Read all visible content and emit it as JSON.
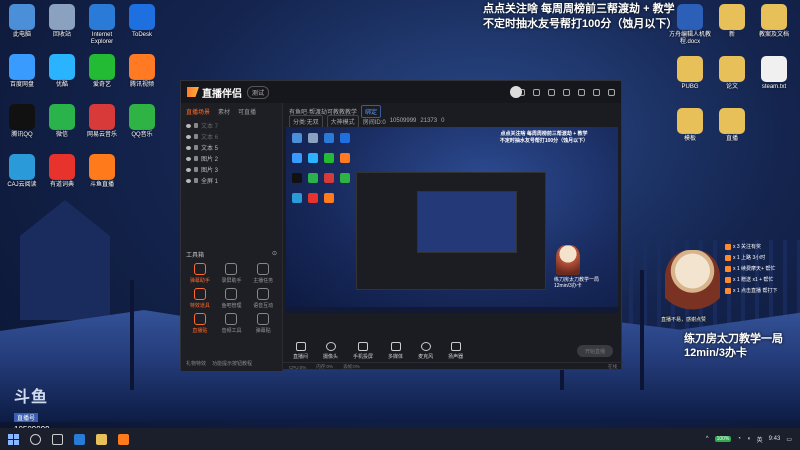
{
  "desktop": {
    "icons_left": [
      {
        "label": "此电脑",
        "icon": "computer-icon",
        "color": "#4a8fd8"
      },
      {
        "label": "回收站",
        "icon": "recycle-bin-icon",
        "color": "#8aa2c0"
      },
      {
        "label": "Internet Explorer",
        "icon": "ie-icon",
        "color": "#2a7ad8"
      },
      {
        "label": "ToDesk",
        "icon": "todesk-icon",
        "color": "#1e6fe0"
      },
      {
        "label": "百度网盘",
        "icon": "baidu-netdisk-icon",
        "color": "#3a9bff"
      },
      {
        "label": "优酷",
        "icon": "youku-icon",
        "color": "#2ab3ff"
      },
      {
        "label": "爱奇艺",
        "icon": "iqiyi-icon",
        "color": "#22bb33"
      },
      {
        "label": "腾讯视频",
        "icon": "tencent-video-icon",
        "color": "#ff7a22"
      },
      {
        "label": "腾讯QQ",
        "icon": "qq-icon",
        "color": "#111111"
      },
      {
        "label": "微信",
        "icon": "wechat-icon",
        "color": "#29b34a"
      },
      {
        "label": "网易云音乐",
        "icon": "netease-music-icon",
        "color": "#d83a3a"
      },
      {
        "label": "QQ音乐",
        "icon": "qq-music-icon",
        "color": "#2fb344"
      },
      {
        "label": "CAJ云阅读",
        "icon": "caj-icon",
        "color": "#2a9ad8"
      },
      {
        "label": "有道词典",
        "icon": "youdao-icon",
        "color": "#e8322c"
      },
      {
        "label": "斗鱼直播",
        "icon": "douyu-icon",
        "color": "#ff7a1a"
      }
    ],
    "icons_right": [
      {
        "label": "方舟编辑人机教程.docx",
        "icon": "word-doc-icon",
        "color": "#2b5fb8"
      },
      {
        "label": "新",
        "icon": "folder-icon",
        "color": "#e8c05a"
      },
      {
        "label": "教案及文档",
        "icon": "folder-icon",
        "color": "#e8c05a"
      },
      {
        "label": "PUBG",
        "icon": "folder-icon",
        "color": "#e8c05a"
      },
      {
        "label": "论文",
        "icon": "folder-icon",
        "color": "#e8c05a"
      },
      {
        "label": "steam.txt",
        "icon": "txt-file-icon",
        "color": "#f0f0f0"
      },
      {
        "label": "模板",
        "icon": "folder-icon",
        "color": "#e8c05a"
      },
      {
        "label": "直播",
        "icon": "folder-icon",
        "color": "#e8c05a"
      }
    ]
  },
  "overlay_top": [
    "点点关注啥 每周周榜前三帮渡劫 + 教学",
    "不定时抽水友号帮打100分（蚀月以下）"
  ],
  "app": {
    "name": "直播伴侣",
    "version_chip": "测试",
    "left_tabs": [
      "直播场景",
      "素材",
      "可直播"
    ],
    "scenes": [
      {
        "label": "文本 7",
        "dim": true
      },
      {
        "label": "文本 6",
        "dim": true
      },
      {
        "label": "文本 5",
        "dim": false
      },
      {
        "label": "图片 2",
        "dim": false
      },
      {
        "label": "图片 3",
        "dim": false
      },
      {
        "label": "全屏 1",
        "dim": false
      }
    ],
    "tools_head": "工具箱",
    "tools": [
      {
        "label": "弹幕助手",
        "hot": true
      },
      {
        "label": "录屏助手",
        "hot": false
      },
      {
        "label": "主播任务",
        "hot": false
      },
      {
        "label": "特效道具",
        "hot": true
      },
      {
        "label": "鱼吧管理",
        "hot": false
      },
      {
        "label": "语音互动",
        "hot": false
      },
      {
        "label": "直播贴",
        "hot": true
      },
      {
        "label": "音频工具",
        "hot": false
      },
      {
        "label": "弹幕贴",
        "hot": false
      }
    ],
    "left_footer": [
      "礼物特效",
      "功能提示按钮教程"
    ],
    "room_bar": {
      "title": "有鱼吧·帮渡劫可教教教学",
      "chip": "绑定",
      "tags": [
        "分类:无双",
        "大神模式"
      ],
      "id": "房间ID:0",
      "room_no": "10509999",
      "viewers": "21373",
      "fans": "0"
    },
    "controls": [
      "直播间",
      "摄像头",
      "手机投屏",
      "多媒体",
      "麦克风",
      "扬声器"
    ],
    "start_button": "开始直播",
    "status": [
      "CPU:0%",
      "内存:0%",
      "丢帧:0%"
    ],
    "status_right": "在线"
  },
  "preview": {
    "overlay": [
      "点点关注啥 每周周榜前三帮渡劫 + 教学",
      "不定时抽水友号帮打100分（蚀月以下）"
    ],
    "caption": [
      "练刀房太刀教学一局",
      "12min/3办卡"
    ]
  },
  "streamer": {
    "caption": "直播不易，感谢点赞",
    "bullets": [
      "x 3 关注有奖",
      "x 1 上路 3小时",
      "x 1 续费摩天+ 帮忙",
      "x 1 赠送 x1 + 帮忙",
      "x 1 点击直播 帮打下"
    ],
    "teach_line1": "练刀房太刀教学一局",
    "teach_line2": "12min/3办卡"
  },
  "douyu": {
    "logo": "斗鱼",
    "tag": "直播号",
    "room": "10509999"
  },
  "taskbar": {
    "time": "9:43",
    "tray_badge": "100%",
    "lang": "英"
  }
}
